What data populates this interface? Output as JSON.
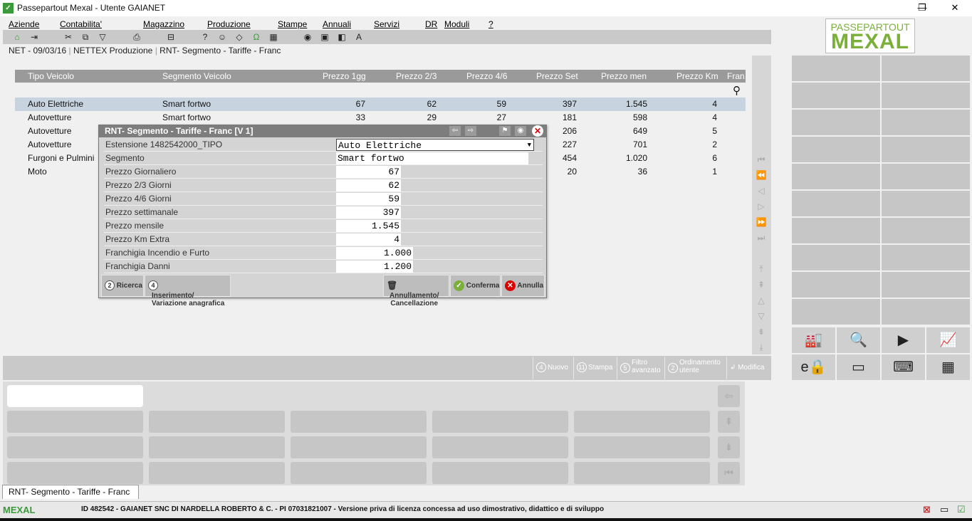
{
  "window": {
    "title": "Passepartout Mexal - Utente GAIANET",
    "minimize": "—",
    "maximize": "❐",
    "close": "✕"
  },
  "menu": [
    "Aziende",
    "Contabilita'",
    "Magazzino",
    "Produzione",
    "Stampe",
    "Annuali",
    "Servizi",
    "DR",
    "Moduli",
    "?"
  ],
  "breadcrumb": {
    "part1": "NET - 09/03/16",
    "part2": "NETTEX Produzione",
    "part3": "RNT- Segmento - Tariffe - Franc"
  },
  "logo": {
    "line1": "PASSEPARTOUT",
    "line2": "MEXAL"
  },
  "table": {
    "columns": [
      "Tipo Veicolo",
      "Segmento Veicolo",
      "Prezzo 1gg",
      "Prezzo 2/3",
      "Prezzo 4/6",
      "Prezzo Set",
      "Prezzo men",
      "Prezzo Km",
      "Fran"
    ],
    "rows": [
      [
        "Auto Elettriche",
        "Smart fortwo",
        "67",
        "62",
        "59",
        "397",
        "1.545",
        "4"
      ],
      [
        "Autovetture",
        "Smart fortwo",
        "33",
        "29",
        "27",
        "181",
        "598",
        "4"
      ],
      [
        "Autovetture",
        "",
        "",
        "",
        "",
        "206",
        "649",
        "5"
      ],
      [
        "Autovetture",
        "",
        "",
        "",
        "",
        "227",
        "701",
        "2"
      ],
      [
        "Furgoni e Pulmini",
        "",
        "",
        "",
        "",
        "454",
        "1.020",
        "6"
      ],
      [
        "Moto",
        "",
        "",
        "",
        "",
        "20",
        "36",
        "1"
      ]
    ]
  },
  "dialog": {
    "title": "RNT- Segmento - Tariffe - Franc [V 1]",
    "fields": [
      {
        "label": "Estensione 1482542000_TIPO",
        "value": "Auto Elettriche"
      },
      {
        "label": "Segmento",
        "value": "Smart fortwo"
      },
      {
        "label": "Prezzo Giornaliero",
        "value": "67"
      },
      {
        "label": "Prezzo 2/3 Giorni",
        "value": "62"
      },
      {
        "label": "Prezzo 4/6 Giorni",
        "value": "59"
      },
      {
        "label": "Prezzo settimanale",
        "value": "397"
      },
      {
        "label": "Prezzo mensile",
        "value": "1.545"
      },
      {
        "label": "Prezzo Km Extra",
        "value": "4"
      },
      {
        "label": "Franchigia Incendio e Furto",
        "value": "1.000"
      },
      {
        "label": "Franchigia Danni",
        "value": "1.200"
      }
    ],
    "buttons": {
      "ricerca_key": "2",
      "ricerca": "Ricerca",
      "inserimento_key": "4",
      "inserimento_l1": "Inserimento/",
      "inserimento_l2": "Variazione anagrafica",
      "annullamento_l1": "Annullamento/",
      "annullamento_l2": "Cancellazione",
      "conferma": "Conferma",
      "annulla": "Annulla"
    }
  },
  "actionbar": {
    "nuovo_key": "4",
    "nuovo": "Nuovo",
    "stampa_key": "11",
    "stampa": "Stampa",
    "filtro_key": "5",
    "filtro_l1": "Filtro",
    "filtro_l2": "avanzato",
    "ordinamento_key": "2",
    "ordinamento_l1": "Ordinamento",
    "ordinamento_l2": "utente",
    "modifica": "Modifica"
  },
  "bottom_tab": "RNT- Segmento - Tariffe - Franc",
  "status": {
    "brand": "MEXAL",
    "info": "ID 482542 - GAIANET SNC DI NARDELLA ROBERTO & C. - PI 07031821007 - Versione priva di licenza concessa ad uso dimostrativo, didattico e di sviluppo"
  },
  "colors": {
    "accent": "#7ab03a",
    "header": "#9a9a9a",
    "selected_row": "#c8d3e0"
  }
}
